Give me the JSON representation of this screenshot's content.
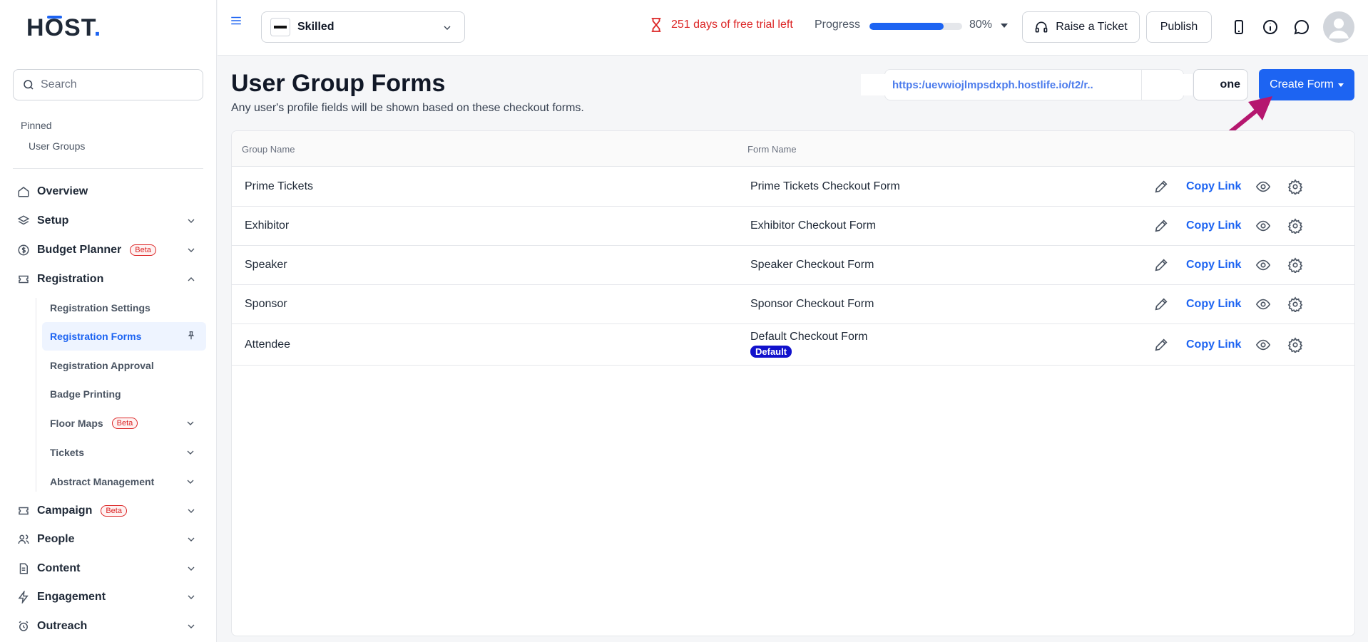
{
  "brand": {
    "logo_h": "H",
    "logo_o": "O",
    "logo_rest": "ST",
    "logo_dot": "."
  },
  "sidebar": {
    "search_placeholder": "Search",
    "pinned_label": "Pinned",
    "pinned_items": [
      "User Groups"
    ],
    "nav": [
      {
        "label": "Overview",
        "icon": "home-icon"
      },
      {
        "label": "Setup",
        "icon": "layers-icon"
      },
      {
        "label": "Budget Planner",
        "icon": "dollar-icon",
        "badge": "Beta"
      },
      {
        "label": "Registration",
        "icon": "ticket-icon"
      },
      {
        "label": "Campaign",
        "icon": "ticket-icon",
        "badge": "Beta"
      },
      {
        "label": "People",
        "icon": "users-icon"
      },
      {
        "label": "Content",
        "icon": "file-icon"
      },
      {
        "label": "Engagement",
        "icon": "bolt-icon"
      },
      {
        "label": "Outreach",
        "icon": "alarm-icon"
      }
    ],
    "registration_sub": [
      {
        "label": "Registration Settings"
      },
      {
        "label": "Registration Forms"
      },
      {
        "label": "Registration Approval"
      },
      {
        "label": "Badge Printing"
      },
      {
        "label": "Floor Maps",
        "badge": "Beta"
      },
      {
        "label": "Tickets"
      },
      {
        "label": "Abstract Management"
      }
    ]
  },
  "topbar": {
    "event_name": "Skilled",
    "trial_text": "251 days of free trial left",
    "progress_label": "Progress",
    "progress_value": "80%",
    "progress_fraction": 0.8,
    "raise_ticket": "Raise a Ticket",
    "publish": "Publish"
  },
  "main": {
    "title": "User Group Forms",
    "subtitle": "Any user's profile fields will be shown based on these checkout forms.",
    "url": "https:/uevwiojlmpsdxph.hostlife.io/t2/r..",
    "done_label": "one",
    "create_form": "Create Form",
    "columns": [
      "Group Name",
      "Form Name"
    ],
    "rows": [
      {
        "group": "Prime Tickets",
        "form": "Prime Tickets Checkout Form",
        "copy": "Copy Link"
      },
      {
        "group": "Exhibitor",
        "form": "Exhibitor Checkout Form",
        "copy": "Copy Link"
      },
      {
        "group": "Speaker",
        "form": "Speaker Checkout Form",
        "copy": "Copy Link"
      },
      {
        "group": "Sponsor",
        "form": "Sponsor Checkout Form",
        "copy": "Copy Link"
      },
      {
        "group": "Attendee",
        "form": "Default Checkout Form",
        "badge": "Default",
        "copy": "Copy Link"
      }
    ]
  },
  "colors": {
    "accent": "#1d64f2",
    "danger": "#dc2626",
    "arrow": "#b5176f",
    "badge": "#1111cc"
  }
}
